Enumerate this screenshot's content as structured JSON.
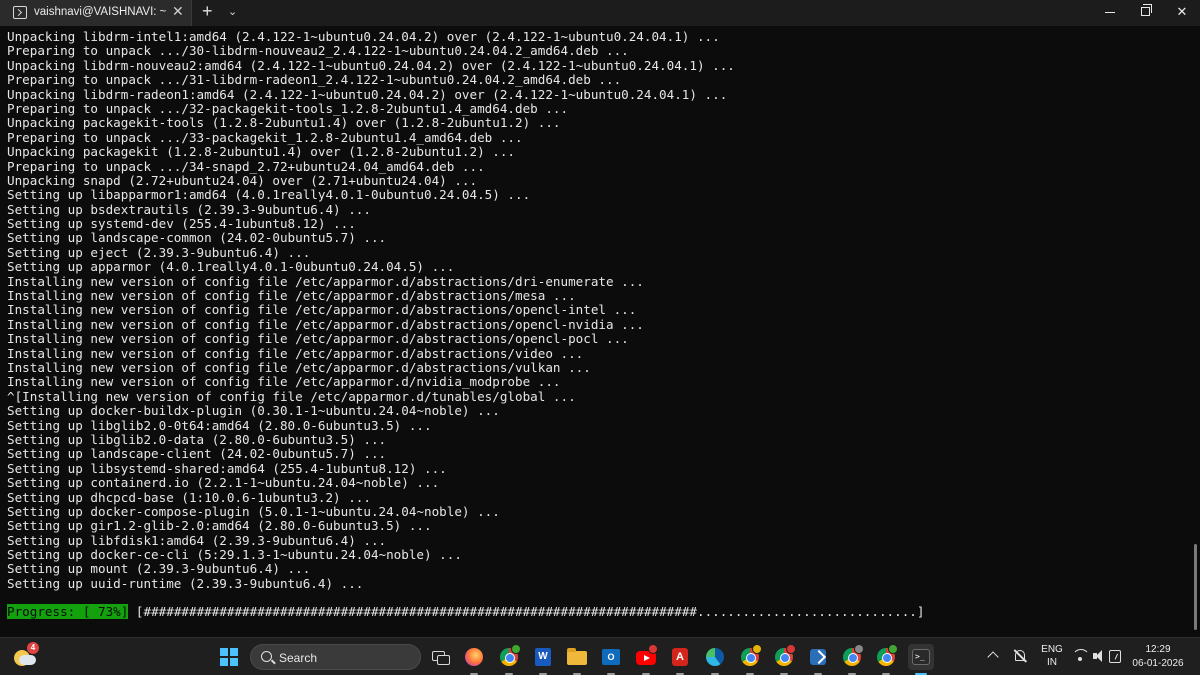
{
  "window": {
    "tab_title": "vaishnavi@VAISHNAVI: ~",
    "tab_close": "✕",
    "new_tab": "+",
    "tab_dropdown": "⌄",
    "close": "✕"
  },
  "terminal": {
    "lines": [
      "Unpacking libdrm-intel1:amd64 (2.4.122-1~ubuntu0.24.04.2) over (2.4.122-1~ubuntu0.24.04.1) ...",
      "Preparing to unpack .../30-libdrm-nouveau2_2.4.122-1~ubuntu0.24.04.2_amd64.deb ...",
      "Unpacking libdrm-nouveau2:amd64 (2.4.122-1~ubuntu0.24.04.2) over (2.4.122-1~ubuntu0.24.04.1) ...",
      "Preparing to unpack .../31-libdrm-radeon1_2.4.122-1~ubuntu0.24.04.2_amd64.deb ...",
      "Unpacking libdrm-radeon1:amd64 (2.4.122-1~ubuntu0.24.04.2) over (2.4.122-1~ubuntu0.24.04.1) ...",
      "Preparing to unpack .../32-packagekit-tools_1.2.8-2ubuntu1.4_amd64.deb ...",
      "Unpacking packagekit-tools (1.2.8-2ubuntu1.4) over (1.2.8-2ubuntu1.2) ...",
      "Preparing to unpack .../33-packagekit_1.2.8-2ubuntu1.4_amd64.deb ...",
      "Unpacking packagekit (1.2.8-2ubuntu1.4) over (1.2.8-2ubuntu1.2) ...",
      "Preparing to unpack .../34-snapd_2.72+ubuntu24.04_amd64.deb ...",
      "Unpacking snapd (2.72+ubuntu24.04) over (2.71+ubuntu24.04) ...",
      "Setting up libapparmor1:amd64 (4.0.1really4.0.1-0ubuntu0.24.04.5) ...",
      "Setting up bsdextrautils (2.39.3-9ubuntu6.4) ...",
      "Setting up systemd-dev (255.4-1ubuntu8.12) ...",
      "Setting up landscape-common (24.02-0ubuntu5.7) ...",
      "Setting up eject (2.39.3-9ubuntu6.4) ...",
      "Setting up apparmor (4.0.1really4.0.1-0ubuntu0.24.04.5) ...",
      "Installing new version of config file /etc/apparmor.d/abstractions/dri-enumerate ...",
      "Installing new version of config file /etc/apparmor.d/abstractions/mesa ...",
      "Installing new version of config file /etc/apparmor.d/abstractions/opencl-intel ...",
      "Installing new version of config file /etc/apparmor.d/abstractions/opencl-nvidia ...",
      "Installing new version of config file /etc/apparmor.d/abstractions/opencl-pocl ...",
      "Installing new version of config file /etc/apparmor.d/abstractions/video ...",
      "Installing new version of config file /etc/apparmor.d/abstractions/vulkan ...",
      "Installing new version of config file /etc/apparmor.d/nvidia_modprobe ...",
      "^[Installing new version of config file /etc/apparmor.d/tunables/global ...",
      "Setting up docker-buildx-plugin (0.30.1-1~ubuntu.24.04~noble) ...",
      "Setting up libglib2.0-0t64:amd64 (2.80.0-6ubuntu3.5) ...",
      "Setting up libglib2.0-data (2.80.0-6ubuntu3.5) ...",
      "Setting up landscape-client (24.02-0ubuntu5.7) ...",
      "Setting up libsystemd-shared:amd64 (255.4-1ubuntu8.12) ...",
      "Setting up containerd.io (2.2.1-1~ubuntu.24.04~noble) ...",
      "Setting up dhcpcd-base (1:10.0.6-1ubuntu3.2) ...",
      "Setting up docker-compose-plugin (5.0.1-1~ubuntu.24.04~noble) ...",
      "Setting up gir1.2-glib-2.0:amd64 (2.80.0-6ubuntu3.5) ...",
      "Setting up libfdisk1:amd64 (2.39.3-9ubuntu6.4) ...",
      "Setting up docker-ce-cli (5:29.1.3-1~ubuntu.24.04~noble) ...",
      "Setting up mount (2.39.3-9ubuntu6.4) ...",
      "Setting up uuid-runtime (2.39.3-9ubuntu6.4) ..."
    ],
    "progress": {
      "label": "Progress: [ 73%]",
      "bar": " [#########################################################################.............................]",
      "percent": 73,
      "color": "#13a10e"
    }
  },
  "taskbar": {
    "weather_badge": "4",
    "search_label": "Search",
    "apps": [
      "start-icon",
      "search-icon",
      "task-view-icon",
      "firefox-icon",
      "chrome-icon",
      "word-icon",
      "file-explorer-icon",
      "outlook-icon",
      "youtube-icon",
      "acrobat-icon",
      "edge-icon",
      "chrome-icon",
      "chrome-icon",
      "vscode-icon",
      "virtualbox-icon",
      "chrome-icon",
      "chrome-icon",
      "terminal-icon"
    ],
    "word_letter": "W",
    "outlook_letter": "O",
    "acrobat_letter": "A",
    "tray": {
      "lang_line1": "ENG",
      "lang_line2": "IN",
      "time": "12:29",
      "date": "06-01-2026"
    }
  },
  "colors": {
    "terminal_bg": "#0c0c0c",
    "terminal_fg": "#e6e6e6",
    "progress_green": "#13a10e",
    "accent": "#4cc2ff"
  }
}
